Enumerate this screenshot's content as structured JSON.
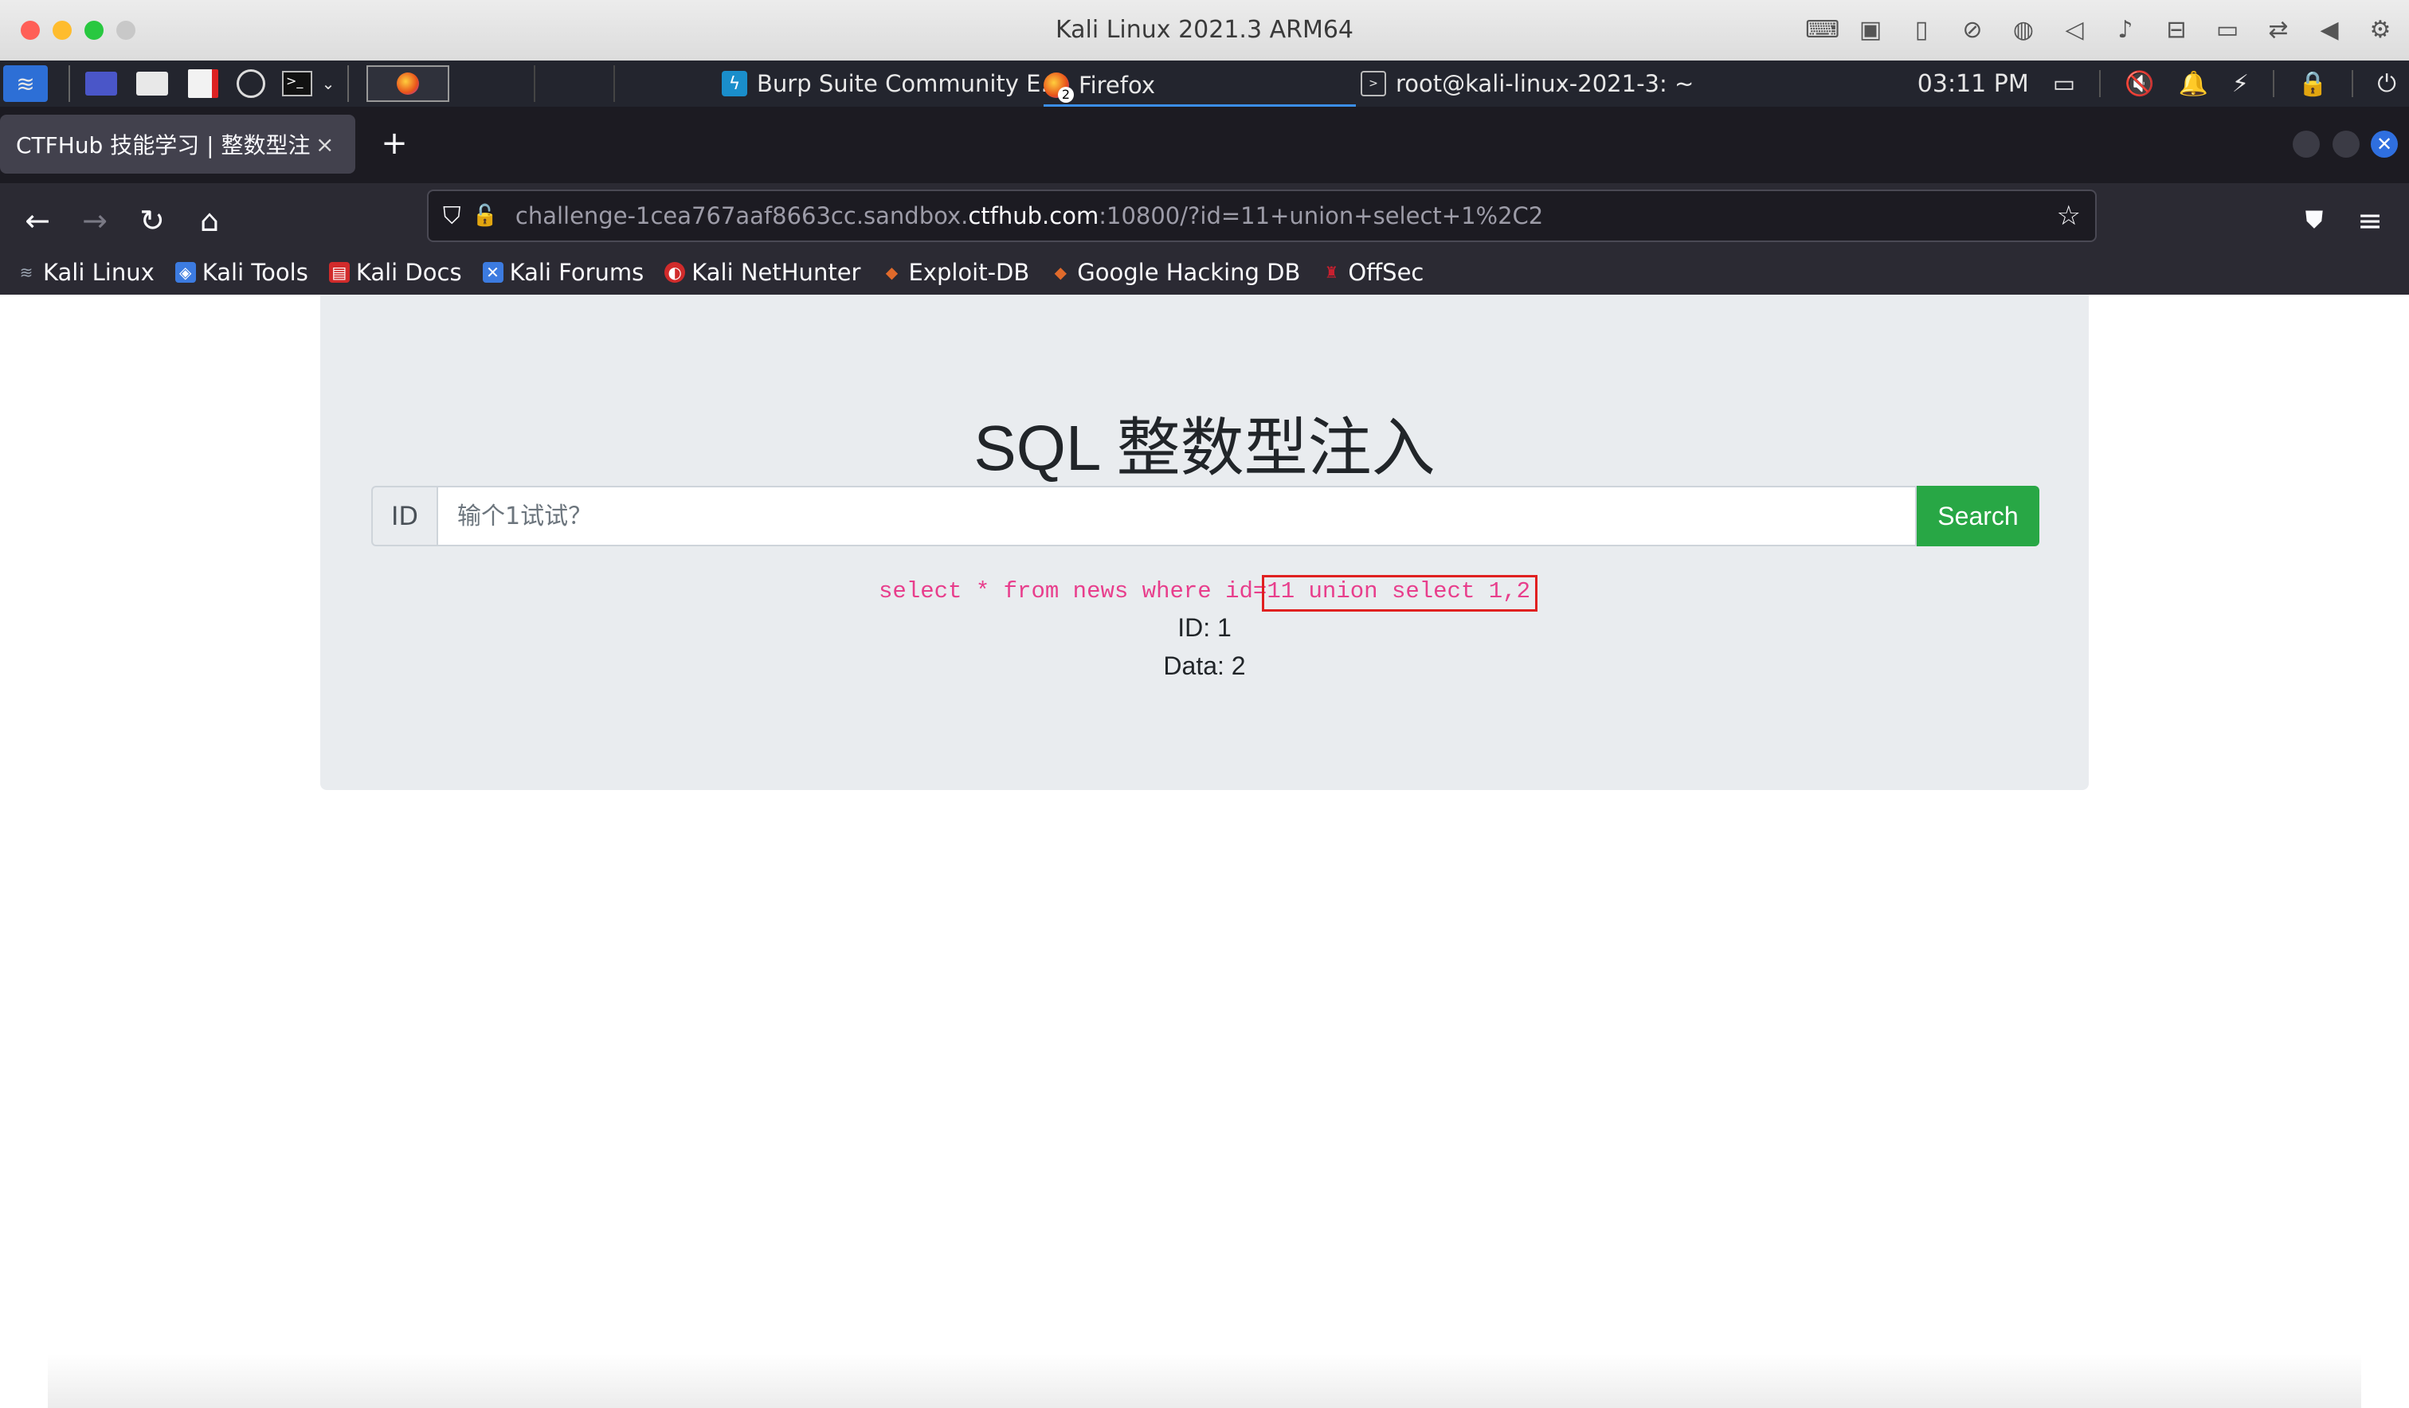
{
  "window": {
    "title": "Kali Linux 2021.3 ARM64",
    "mac_tray_icons": [
      "keyboard-icon",
      "cpu-icon",
      "mouse-icon",
      "camera-off-icon",
      "globe-icon",
      "speaker-icon",
      "microphone-icon",
      "drive-icon",
      "video-icon",
      "share-icon",
      "back-triangle-icon",
      "gear-icon"
    ]
  },
  "panel": {
    "tasks": [
      {
        "label": "Burp Suite Community E...",
        "icon": "burp-icon"
      },
      {
        "label": "Firefox",
        "icon": "firefox-icon",
        "badge": "2"
      },
      {
        "label": "root@kali-linux-2021-3: ~",
        "icon": "terminal-icon"
      }
    ],
    "clock": "03:11 PM"
  },
  "browser": {
    "tab_title": "CTFHub 技能学习 | 整数型注入",
    "tab_close": "×",
    "new_tab": "+",
    "url_prefix": "challenge-1cea767aaf8663cc.sandbox.",
    "url_domain": "ctfhub.com",
    "url_suffix": ":10800/?id=11+union+select+1%2C2",
    "bookmarks": [
      {
        "label": "Kali Linux",
        "icon": "kali-icon",
        "color": "#6f7a8a"
      },
      {
        "label": "Kali Tools",
        "icon": "kali-tools-icon",
        "color": "#3c7be0"
      },
      {
        "label": "Kali Docs",
        "icon": "kali-docs-icon",
        "color": "#d12b2b"
      },
      {
        "label": "Kali Forums",
        "icon": "kali-forums-icon",
        "color": "#3c7be0"
      },
      {
        "label": "Kali NetHunter",
        "icon": "nethunter-icon",
        "color": "#d12b2b"
      },
      {
        "label": "Exploit-DB",
        "icon": "exploit-db-icon",
        "color": "#e06a2b"
      },
      {
        "label": "Google Hacking DB",
        "icon": "ghdb-icon",
        "color": "#e06a2b"
      },
      {
        "label": "OffSec",
        "icon": "offsec-icon",
        "color": "#c8202f"
      }
    ]
  },
  "page": {
    "title": "SQL 整数型注入",
    "id_label": "ID",
    "search_placeholder": "输个1试试？",
    "search_button": "Search",
    "sql_prefix": "select * from news where id=",
    "sql_injected": "11 union select 1,2",
    "result_id": "ID: 1",
    "result_data": "Data: 2"
  },
  "colors": {
    "accent_button": "#28a745",
    "sql_text": "#e83e8c",
    "highlight_box": "#e02020"
  }
}
